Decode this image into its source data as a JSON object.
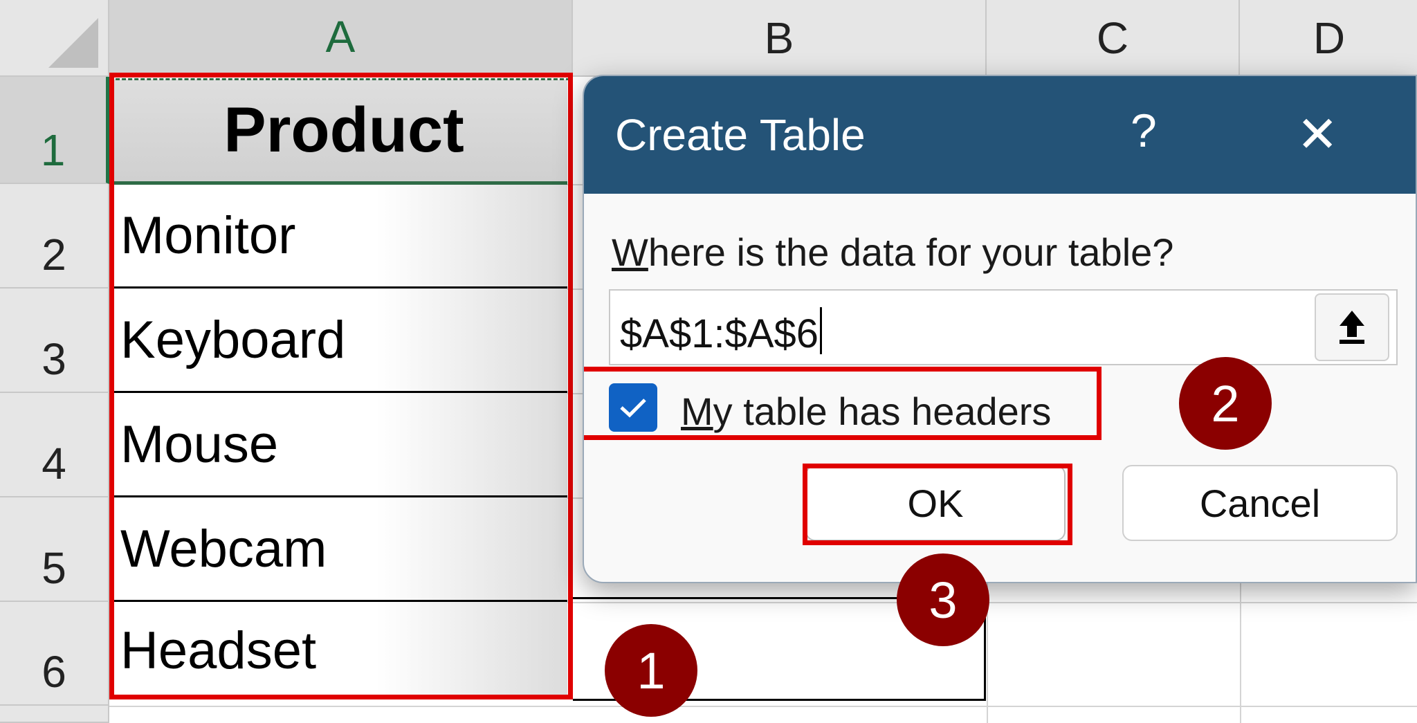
{
  "columns": [
    "A",
    "B",
    "C",
    "D"
  ],
  "rows": [
    "1",
    "2",
    "3",
    "4",
    "5",
    "6"
  ],
  "cells": {
    "a1": "Product",
    "a2": "Monitor",
    "a3": "Keyboard",
    "a4": "Mouse",
    "a5": "Webcam",
    "a6": "Headset"
  },
  "dialog": {
    "title": "Create Table",
    "help": "?",
    "close": "✕",
    "prompt_accel": "W",
    "prompt_rest": "here is the data for your table?",
    "range_value": "$A$1:$A$6",
    "checkbox_checked": true,
    "checkbox_accel": "M",
    "checkbox_rest": "y table has headers",
    "ok_label": "OK",
    "cancel_label": "Cancel"
  },
  "steps": [
    "1",
    "2",
    "3"
  ],
  "colors": {
    "titlebar": "#245377",
    "highlight": "#e00000",
    "badge": "#8b0000",
    "checkbox": "#1062c4",
    "selection": "#217346"
  }
}
